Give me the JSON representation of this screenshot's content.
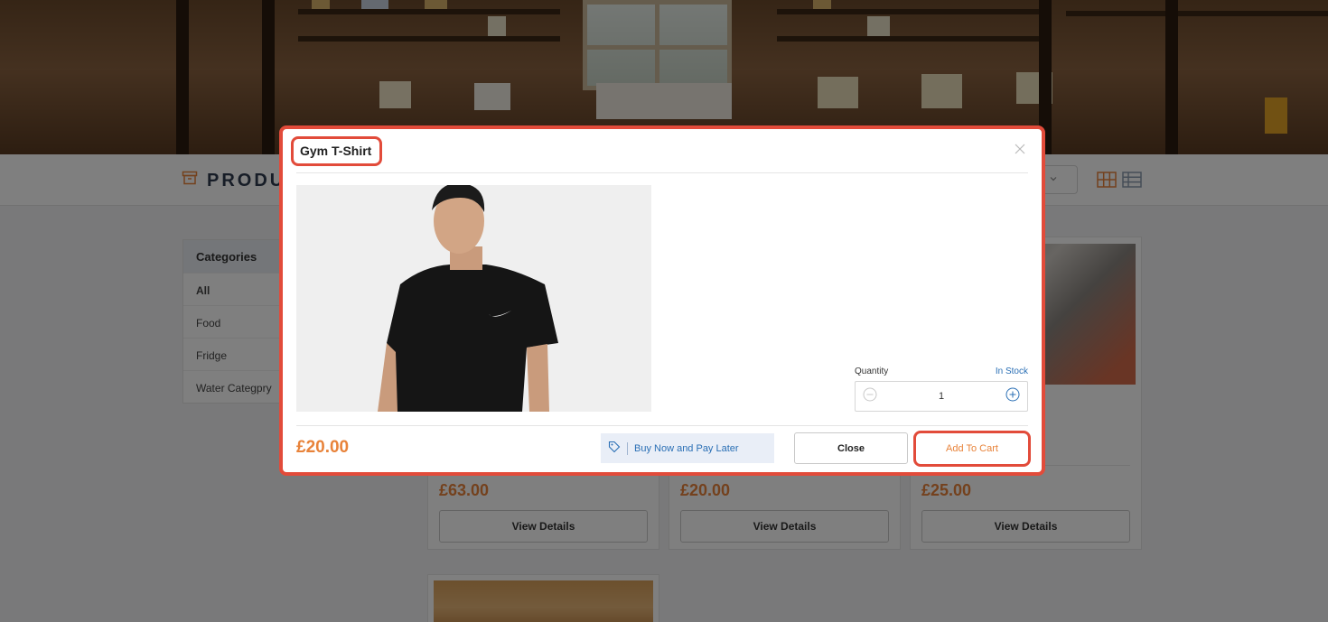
{
  "page": {
    "title_visible": "PRODU"
  },
  "categories": {
    "header": "Categories",
    "items": [
      {
        "label": "All",
        "active": true
      },
      {
        "label": "Food",
        "active": false
      },
      {
        "label": "Fridge",
        "active": false
      },
      {
        "label": "Water Categpry",
        "active": false
      }
    ]
  },
  "cards": [
    {
      "price": "£63.00",
      "button": "View Details"
    },
    {
      "price": "£20.00",
      "button": "View Details"
    },
    {
      "price": "£25.00",
      "button": "View Details"
    }
  ],
  "modal": {
    "title": "Gym T-Shirt",
    "quantity_label": "Quantity",
    "stock_status": "In Stock",
    "quantity_value": "1",
    "price": "£20.00",
    "bnpl_label": "Buy Now and Pay Later",
    "close_label": "Close",
    "add_to_cart_label": "Add To Cart"
  },
  "icons": {
    "title_icon": "archive-box-icon",
    "grid_view": "grid-view-icon",
    "list_view": "list-view-icon",
    "tag": "tag-icon",
    "minus": "minus-circle-icon",
    "plus": "plus-circle-icon",
    "close": "close-icon",
    "chevron": "chevron-down-icon"
  },
  "colors": {
    "accent_orange": "#e8833a",
    "highlight_red": "#e24b3a",
    "link_blue": "#2a6fb5"
  }
}
